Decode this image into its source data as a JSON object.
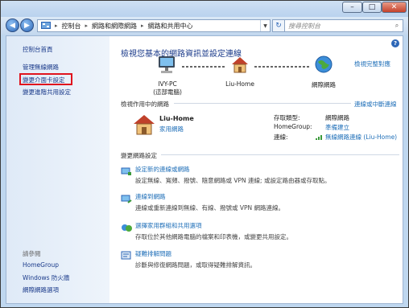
{
  "window": {
    "min": "–",
    "max": "□",
    "close": "✕"
  },
  "address": {
    "segments": [
      "控制台",
      "網路和網際網路",
      "網路和共用中心"
    ],
    "search_placeholder": "搜尋控制台"
  },
  "sidebar": {
    "items": [
      "控制台首頁",
      "管理無線網路",
      "變更介面卡設定",
      "變更進階共用設定"
    ],
    "see_also": "請參閱",
    "see_also_items": [
      "HomeGroup",
      "Windows 防火牆",
      "網際網路選項"
    ]
  },
  "main": {
    "title": "檢視您基本的網路資訊並設定連線",
    "full_map": "檢視完整對應",
    "nodes": [
      {
        "label": "IVY-PC",
        "sub": "(這部電腦)"
      },
      {
        "label": "Liu-Home",
        "sub": ""
      },
      {
        "label": "網際網路",
        "sub": ""
      }
    ],
    "active_header": "檢視作用中的網路",
    "connect_link": "連線或中斷連線",
    "network_name": "Liu-Home",
    "network_type": "家用網路",
    "access_type_label": "存取類型:",
    "access_type_value": "網際網路",
    "homegroup_label": "HomeGroup:",
    "homegroup_value": "準備建立",
    "connections_label": "連線:",
    "connections_value": "無線網路連線 (Liu-Home)",
    "change_header": "變更網路設定",
    "tasks": [
      {
        "title": "設定新的連線或網路",
        "desc": "設定無線、寬頻、撥號、隨意網路或 VPN 連線; 或設定路由器或存取點。"
      },
      {
        "title": "連線到網路",
        "desc": "連線或重新連線到無線、有線、撥號或 VPN 網路連線。"
      },
      {
        "title": "選擇家用群組和共用選項",
        "desc": "存取位於其他網路電腦的檔案和印表機，或變更共用設定。"
      },
      {
        "title": "疑難排解問題",
        "desc": "診斷與修復網路問題，或取得疑難排解資訊。"
      }
    ]
  }
}
